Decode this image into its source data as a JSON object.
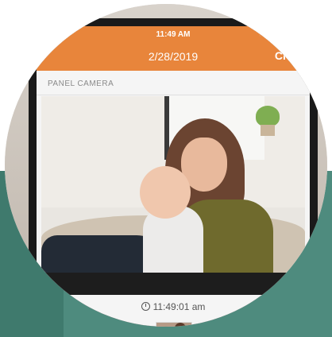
{
  "status_bar": {
    "left": "n ⌔",
    "time": "11:49 AM",
    "right": "◔ ⊕ ➚ ⚲"
  },
  "nav": {
    "title": "2/28/2019",
    "close_label": "Close"
  },
  "section": {
    "label": "PANEL CAMERA"
  },
  "photo": {
    "time_label": "11:49:01 am"
  },
  "colors": {
    "accent": "#e8853b",
    "teal": "#4e8b7e"
  }
}
